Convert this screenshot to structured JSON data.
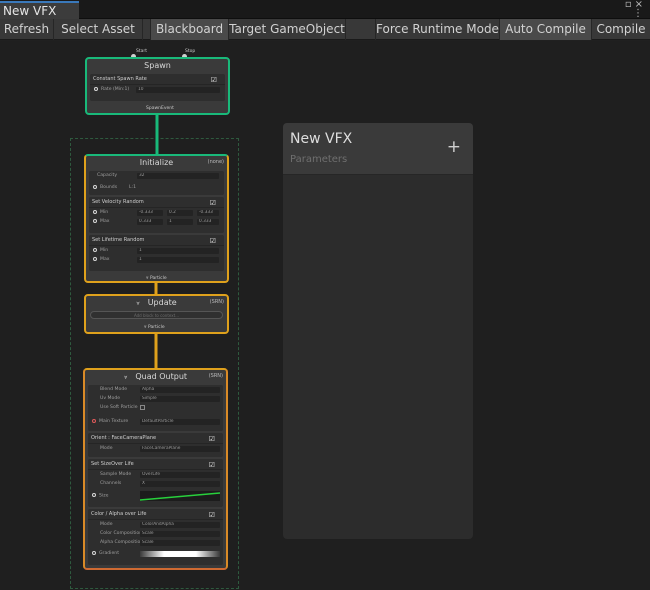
{
  "window": {
    "tab_title": "New VFX",
    "menu_icon": "kebab-menu-icon"
  },
  "toolbar": {
    "refresh": "Refresh",
    "select_asset": "Select Asset",
    "blackboard": "Blackboard",
    "target_gameobject": "Target GameObject",
    "force_runtime_mode": "Force Runtime Mode",
    "auto_compile": "Auto Compile",
    "compile": "Compile"
  },
  "graph": {
    "spawn": {
      "title": "Spawn",
      "in_start": "Start",
      "in_stop": "Stop",
      "block_title": "Constant Spawn Rate",
      "rate_label": "Rate (Min:1)",
      "rate_value": "10",
      "out_label": "SpawnEvent"
    },
    "initialize": {
      "title": "Initialize",
      "tag": "(none)",
      "capacity_label": "Capacity",
      "capacity_value": "32",
      "bounds_label": "Bounds",
      "bounds_value": "L:1",
      "velocity_block": "Set Velocity Random",
      "min_label": "Min",
      "max_label": "Max",
      "velocity_min": [
        "-0.333",
        "0.2",
        "-0.333"
      ],
      "velocity_max": [
        "0.333",
        "1",
        "0.333"
      ],
      "lifetime_block": "Set Lifetime Random",
      "lifetime_min": "1",
      "lifetime_max": "1",
      "out_label": "Particle"
    },
    "update": {
      "title": "Update",
      "tag": "(SRN)",
      "empty_hint": "Add block to context...",
      "in_label": "Particle",
      "out_label": "Particle"
    },
    "output": {
      "title": "Quad Output",
      "tag": "(SRN)",
      "blend_mode_label": "Blend Mode",
      "blend_mode_value": "Alpha",
      "uv_mode_label": "Uv Mode",
      "uv_mode_value": "Simple",
      "use_soft_label": "Use Soft Particle",
      "main_texture_label": "Main Texture",
      "main_texture_value": "DefaultParticle",
      "orient_block": "Orient : FaceCameraPlane",
      "orient_mode_label": "Mode",
      "orient_mode_value": "FaceCameraPlane",
      "size_block": "Set SizeOver Life",
      "sample_mode_label": "Sample Mode",
      "sample_mode_value": "OverLife",
      "channels_label": "Channels",
      "channels_value": "X",
      "size_label": "Size",
      "color_block": "Color / Alpha over Life",
      "color_mode_label": "Mode",
      "color_mode_value": "ColorAndAlpha",
      "color_comp_label": "Color Composition",
      "color_comp_value": "Scale",
      "alpha_comp_label": "Alpha Composition",
      "alpha_comp_value": "Scale",
      "gradient_label": "Gradient"
    }
  },
  "blackboard": {
    "title": "New VFX",
    "subtitle": "Parameters",
    "add_icon": "plus-icon"
  },
  "colors": {
    "spawn_border": "#19b97a",
    "particle_border": "#dfa11c",
    "output_bottom": "#cf6a32",
    "canvas": "#1f1f1f"
  }
}
